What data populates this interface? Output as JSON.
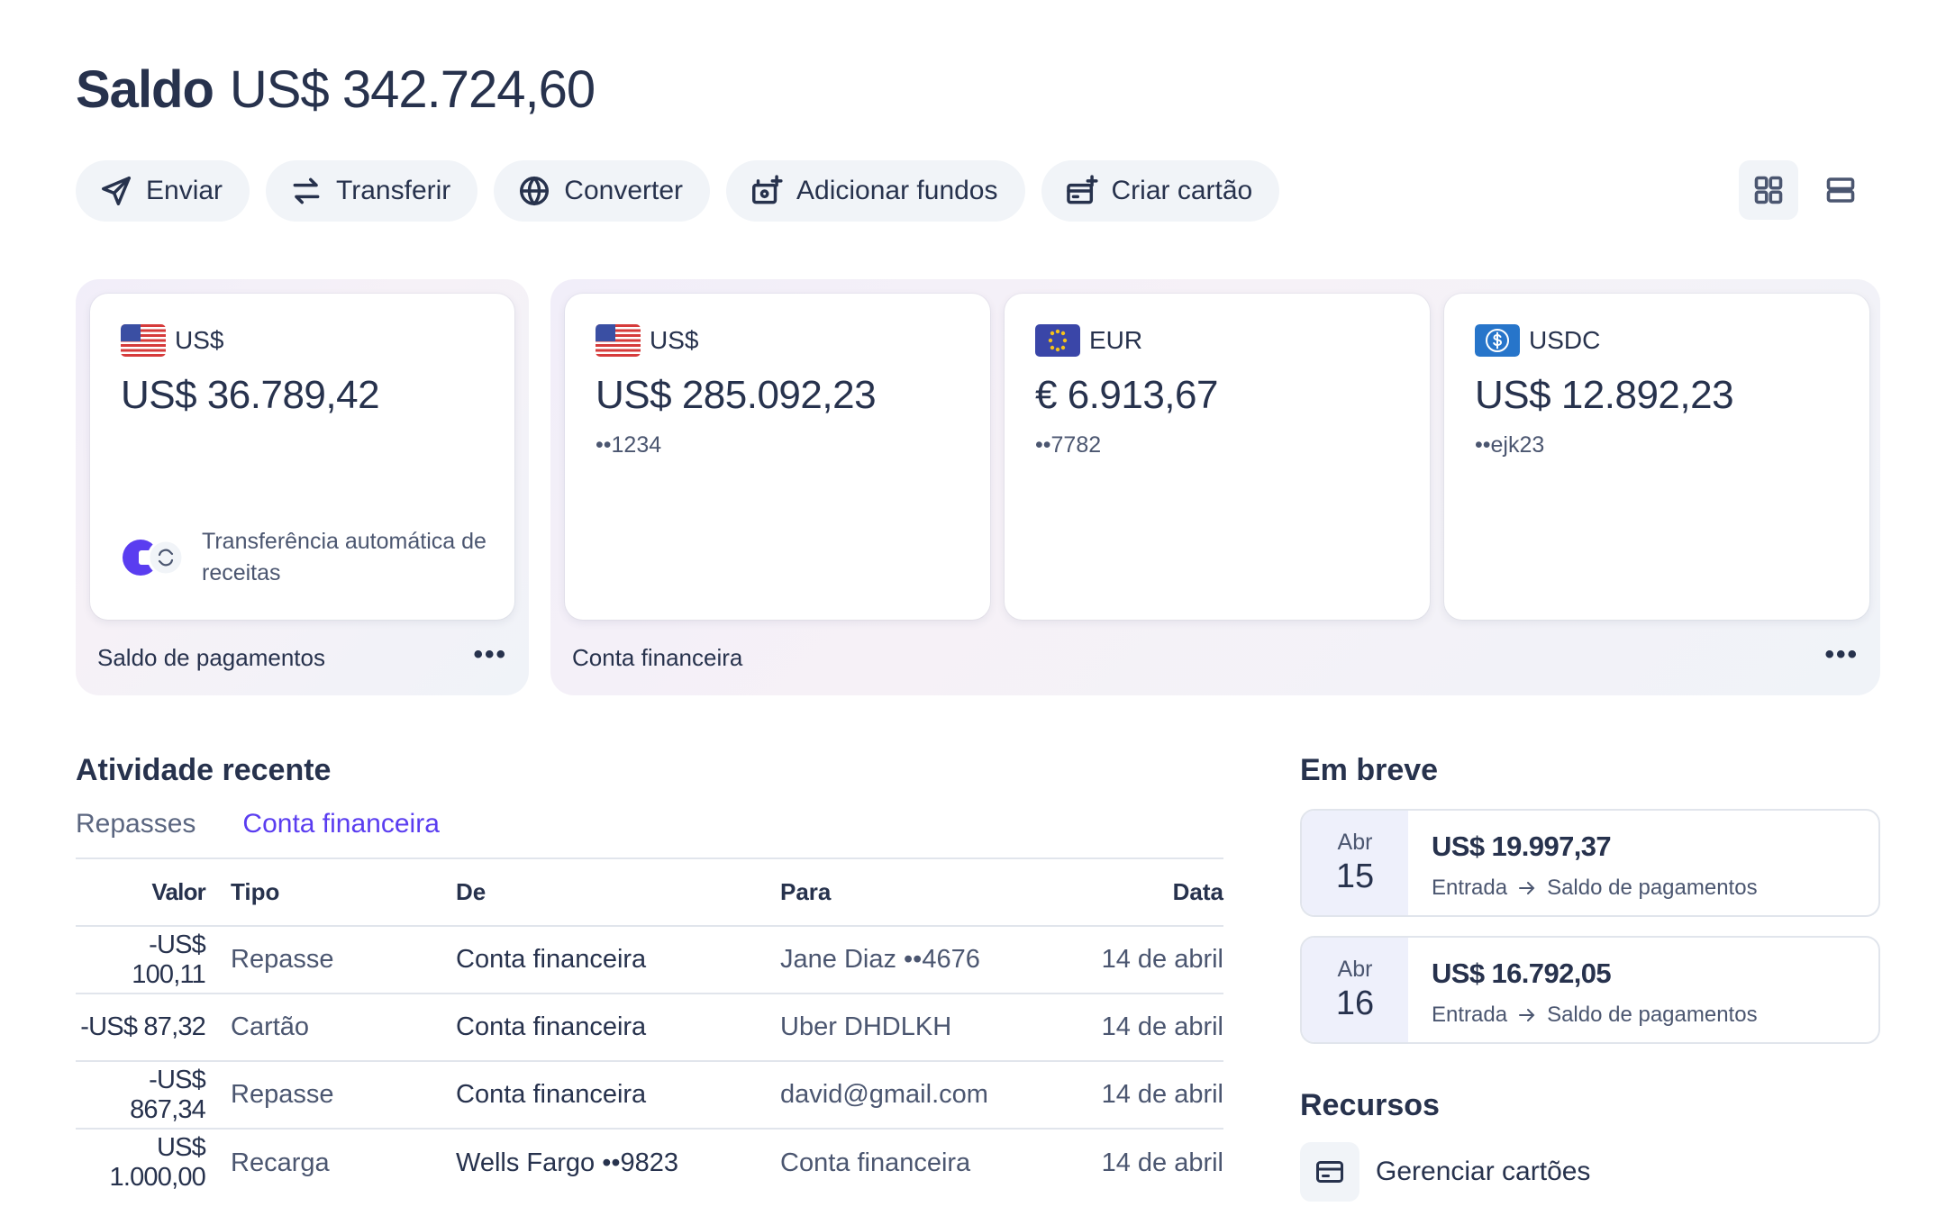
{
  "balance": {
    "label": "Saldo",
    "amount": "US$ 342.724,60"
  },
  "actions": [
    {
      "label": "Enviar",
      "icon": "send-icon"
    },
    {
      "label": "Transferir",
      "icon": "transfer-icon"
    },
    {
      "label": "Converter",
      "icon": "globe-icon"
    },
    {
      "label": "Adicionar fundos",
      "icon": "add-funds-icon"
    },
    {
      "label": "Criar cartão",
      "icon": "create-card-icon"
    }
  ],
  "view_toggle": {
    "grid_icon": "grid-view-icon",
    "list_icon": "list-view-icon",
    "active": "grid"
  },
  "payments_panel": {
    "footer": "Saldo de pagamentos",
    "more": "•••",
    "card": {
      "currency": "US$",
      "amount": "US$ 36.789,42",
      "auto_transfer": "Transferência automática de receitas"
    }
  },
  "financial_panel": {
    "footer": "Conta financeira",
    "more": "•••",
    "cards": [
      {
        "currency": "US$",
        "flag": "us-flag-icon",
        "amount": "US$ 285.092,23",
        "account": "••1234"
      },
      {
        "currency": "EUR",
        "flag": "eu-flag-icon",
        "amount": "€ 6.913,67",
        "account": "••7782"
      },
      {
        "currency": "USDC",
        "flag": "usdc-icon",
        "amount": "US$ 12.892,23",
        "account": "••ejk23"
      }
    ]
  },
  "activity": {
    "title": "Atividade recente",
    "tabs": [
      {
        "label": "Repasses",
        "active": false
      },
      {
        "label": "Conta financeira",
        "active": true
      }
    ],
    "columns": [
      "Valor",
      "Tipo",
      "De",
      "Para",
      "Data"
    ],
    "rows": [
      {
        "valor": "-US$ 100,11",
        "tipo": "Repasse",
        "de": "Conta financeira",
        "para": "Jane Diaz ••4676",
        "data": "14 de abril"
      },
      {
        "valor": "-US$ 87,32",
        "tipo": "Cartão",
        "de": "Conta financeira",
        "para": "Uber DHDLKH",
        "data": "14 de abril"
      },
      {
        "valor": "-US$ 867,34",
        "tipo": "Repasse",
        "de": "Conta financeira",
        "para": "david@gmail.com",
        "data": "14 de abril"
      },
      {
        "valor": "US$ 1.000,00",
        "tipo": "Recarga",
        "de": "Wells Fargo ••9823",
        "para": "Conta financeira",
        "data": "14 de abril"
      }
    ]
  },
  "upcoming": {
    "title": "Em breve",
    "items": [
      {
        "month": "Abr",
        "day": "15",
        "amount": "US$ 19.997,37",
        "from": "Entrada",
        "to": "Saldo de pagamentos"
      },
      {
        "month": "Abr",
        "day": "16",
        "amount": "US$ 16.792,05",
        "from": "Entrada",
        "to": "Saldo de pagamentos"
      }
    ]
  },
  "resources": {
    "title": "Recursos",
    "items": [
      {
        "label": "Gerenciar cartões",
        "icon": "card-icon"
      }
    ]
  },
  "colors": {
    "accent": "#5a3df0",
    "text": "#27324d",
    "muted": "#4b5670",
    "button_bg": "#f1f4f8"
  }
}
